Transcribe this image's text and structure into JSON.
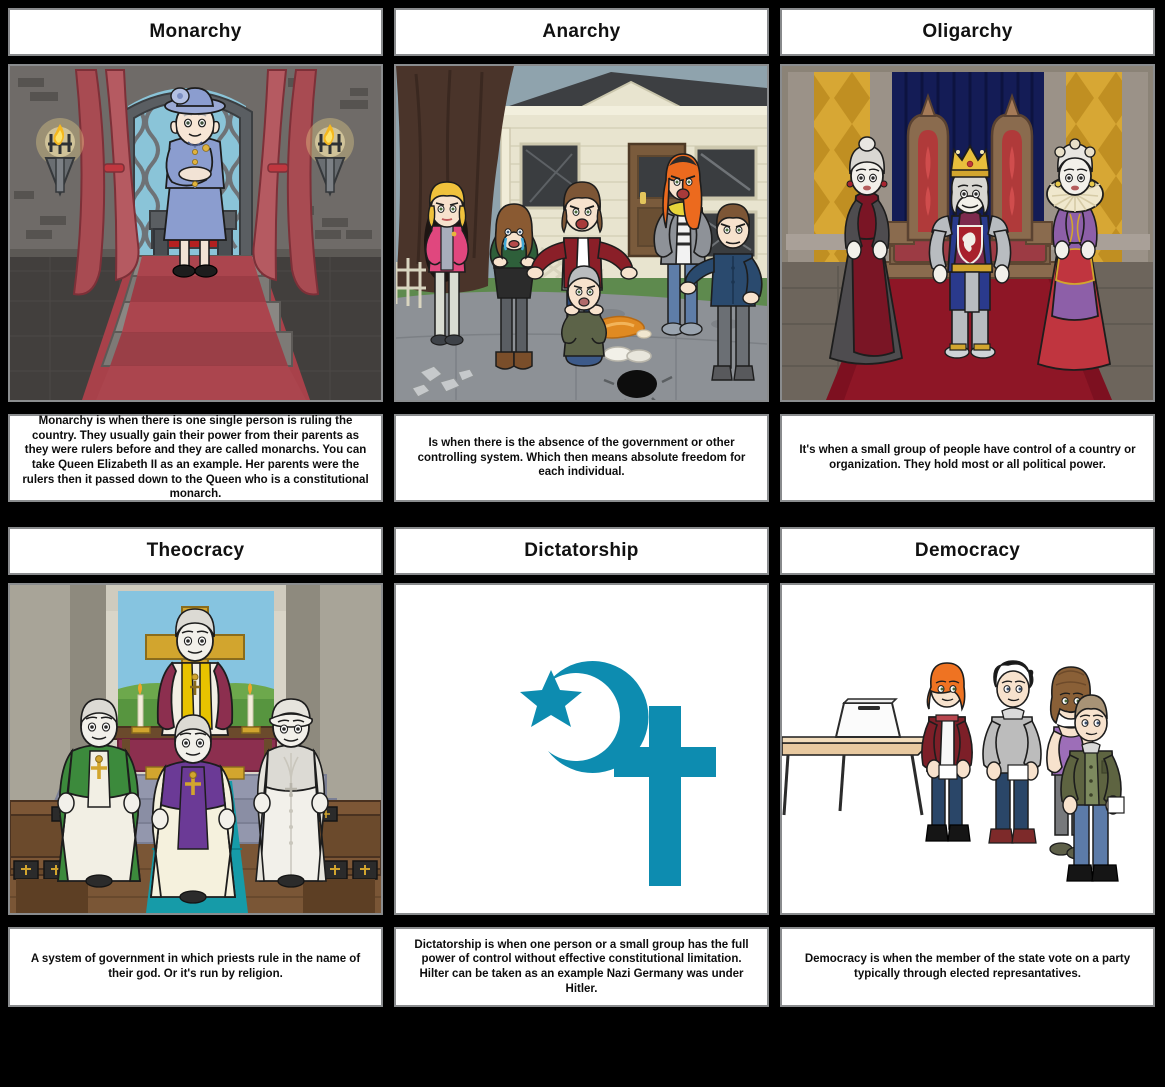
{
  "storyboard": {
    "background_color": "#000000",
    "panel_border_color": "#8a8c8e",
    "panel_background": "#ffffff",
    "accent_teal": "#0d8cb0",
    "rows": [
      {
        "cells": [
          {
            "title": "Monarchy",
            "description": "Monarchy is when there is one single person is ruling the country. They usually gain their power from their parents as they were rulers before and they are called monarchs. You can take Queen Elizabeth II as an example. Her parents were the rulers then it passed down to the Queen who is a constitutional monarch.",
            "scene": "throne-room-queen"
          },
          {
            "title": "Anarchy",
            "description": "Is when there is the absence of the government or other controlling system. Which then means absolute freedom for each individual.",
            "scene": "street-riot-crowd"
          },
          {
            "title": "Oligarchy",
            "description": "It's when a small group of people have control of a country or organization. They hold most or all political power.",
            "scene": "royal-court-three-rulers"
          }
        ]
      },
      {
        "cells": [
          {
            "title": "Theocracy",
            "description": "A system of government in which priests rule in the name of their god. Or it's run by religion.",
            "scene": "church-clergy"
          },
          {
            "title": "Dictatorship",
            "description": "Dictatorship is when one person or a small group has the full power of control without effective constitutional limitation. Hilter can be taken as an example Nazi Germany was under Hitler.",
            "scene": "religious-symbols-crescent-cross"
          },
          {
            "title": "Democracy",
            "description": "Democracy is when the member of the state vote on a party typically through elected represantatives.",
            "scene": "voting-booth-queue"
          }
        ]
      }
    ]
  }
}
